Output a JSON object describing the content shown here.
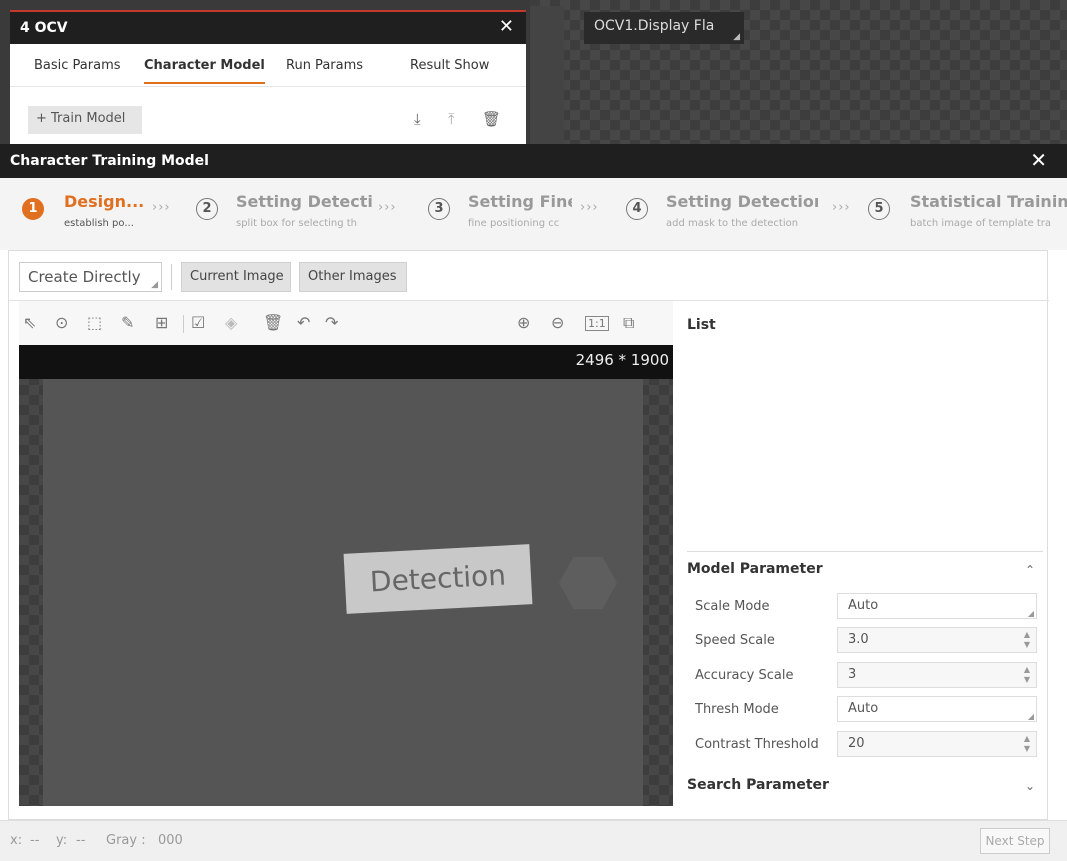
{
  "ocv_panel": {
    "title": "4 OCV",
    "close": "✕",
    "tabs": [
      "Basic Params",
      "Character Model",
      "Run Params",
      "Result Show"
    ],
    "active_tab": 1,
    "train_model_label": "+  Train Model",
    "icons": [
      "download-icon",
      "upload-icon",
      "trash-icon"
    ]
  },
  "display": {
    "dropdown_value": "OCV1.Display Fla"
  },
  "modal": {
    "title": "Character Training Model",
    "close": "✕",
    "steps": [
      {
        "number": "1",
        "title": "Design...",
        "subtitle": "establish po..."
      },
      {
        "number": "2",
        "title": "Setting Detectic",
        "subtitle": "split box for selecting th"
      },
      {
        "number": "3",
        "title": "Setting Fine",
        "subtitle": "fine positioning cc"
      },
      {
        "number": "4",
        "title": "Setting Detectior",
        "subtitle": "add mask to the detection"
      },
      {
        "number": "5",
        "title": "Statistical Training",
        "subtitle": "batch image of template tra"
      }
    ],
    "step_separator": "›››",
    "create_select": "Create Directly",
    "source_buttons": [
      "Current Image",
      "Other Images"
    ],
    "image_size": "2496 * 1900",
    "image_text": "Detection",
    "list_title": "List",
    "model_parameter": {
      "title": "Model Parameter",
      "rows": [
        {
          "label": "Scale Mode",
          "value": "Auto",
          "kind": "select"
        },
        {
          "label": "Speed Scale",
          "value": "3.0",
          "kind": "spin"
        },
        {
          "label": "Accuracy Scale",
          "value": "3",
          "kind": "spin"
        },
        {
          "label": "Thresh Mode",
          "value": "Auto",
          "kind": "select"
        },
        {
          "label": "Contrast Threshold",
          "value": "20",
          "kind": "spin"
        }
      ]
    },
    "search_parameter_title": "Search Parameter",
    "status": {
      "x_label": "x:",
      "x_value": "--",
      "y_label": "y:",
      "y_value": "--",
      "gray_label": "Gray :",
      "gray_value": "000"
    },
    "next_step": "Next Step"
  }
}
